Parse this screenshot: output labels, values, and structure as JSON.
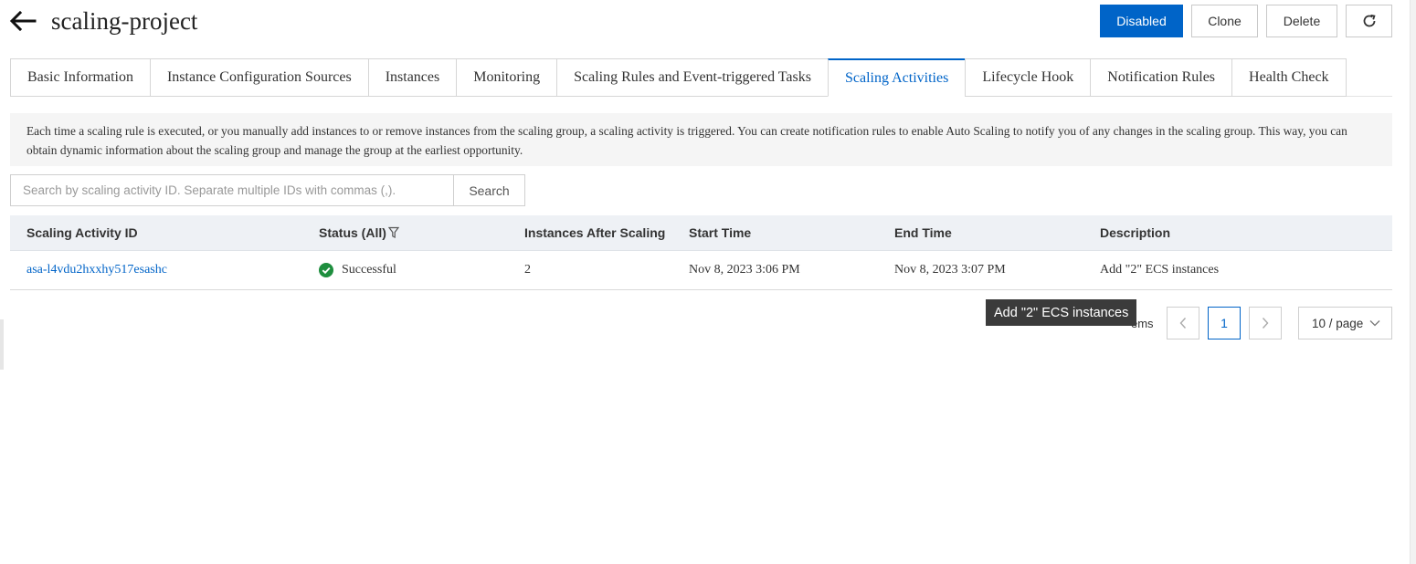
{
  "header": {
    "title": "scaling-project",
    "back_icon": "arrow-left-icon",
    "buttons": {
      "disabled": "Disabled",
      "clone": "Clone",
      "delete": "Delete",
      "refresh_icon": "refresh-icon"
    }
  },
  "tabs": [
    {
      "label": "Basic Information"
    },
    {
      "label": "Instance Configuration Sources"
    },
    {
      "label": "Instances"
    },
    {
      "label": "Monitoring"
    },
    {
      "label": "Scaling Rules and Event-triggered Tasks"
    },
    {
      "label": "Scaling Activities",
      "active": true
    },
    {
      "label": "Lifecycle Hook"
    },
    {
      "label": "Notification Rules"
    },
    {
      "label": "Health Check"
    }
  ],
  "notice": {
    "text": "Each time a scaling rule is executed, or you manually add instances to or remove instances from the scaling group, a scaling activity is triggered. You can create notification rules to enable Auto Scaling to notify you of any changes in the scaling group. This way, you can obtain dynamic information about the scaling group and manage the group at the earliest opportunity."
  },
  "search": {
    "placeholder": "Search by scaling activity ID. Separate multiple IDs with commas (,).",
    "value": "",
    "button": "Search"
  },
  "table": {
    "columns": {
      "id": "Scaling Activity ID",
      "status": "Status (All)",
      "instances": "Instances After Scaling",
      "start": "Start Time",
      "end": "End Time",
      "description": "Description"
    },
    "rows": [
      {
        "id": "asa-l4vdu2hxxhy517esashc",
        "status": "Successful",
        "instances": "2",
        "start": "Nov 8, 2023 3:06 PM",
        "end": "Nov 8, 2023 3:07 PM",
        "description": "Add \"2\" ECS instances"
      }
    ]
  },
  "pagination": {
    "items_text": "ems",
    "current_page": "1",
    "page_size": "10 / page"
  },
  "tooltip": {
    "text": "Add \"2\" ECS instances"
  },
  "colors": {
    "accent": "#0064c8",
    "success": "#1e8e3e",
    "header_bg": "#eef1f5",
    "tooltip_bg": "#3b3b3b"
  }
}
